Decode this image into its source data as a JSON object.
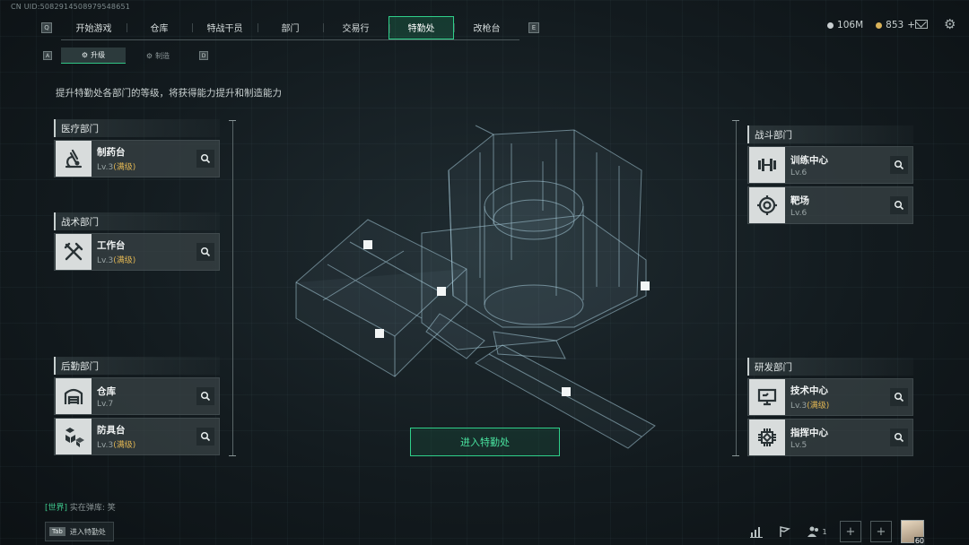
{
  "uid_label": "CN UID:5082914508979548651",
  "nav": {
    "left_key": "Q",
    "right_key": "E",
    "tabs": [
      {
        "label": "开始游戏"
      },
      {
        "label": "仓库"
      },
      {
        "label": "特战干员"
      },
      {
        "label": "部门"
      },
      {
        "label": "交易行"
      },
      {
        "label": "特勤处",
        "active": true
      },
      {
        "label": "改枪台"
      }
    ]
  },
  "currency": {
    "silver": "106M",
    "gold": "853"
  },
  "subnav": {
    "left_key": "A",
    "right_key": "D",
    "tabs": [
      {
        "label": "升级",
        "active": true
      },
      {
        "label": "制造"
      }
    ]
  },
  "description": "提升特勤处各部门的等级，将获得能力提升和制造能力",
  "departments": {
    "medical": {
      "title": "医疗部门",
      "items": [
        {
          "name": "制药台",
          "level": "Lv.3",
          "max": "(满级)",
          "icon": "microscope-icon"
        }
      ]
    },
    "tactical": {
      "title": "战术部门",
      "items": [
        {
          "name": "工作台",
          "level": "Lv.3",
          "max": "(满级)",
          "icon": "tools-icon"
        }
      ]
    },
    "logistics": {
      "title": "后勤部门",
      "items": [
        {
          "name": "仓库",
          "level": "Lv.7",
          "max": "",
          "icon": "warehouse-icon"
        },
        {
          "name": "防具台",
          "level": "Lv.3",
          "max": "(满级)",
          "icon": "armor-crates-icon"
        }
      ]
    },
    "combat": {
      "title": "战斗部门",
      "items": [
        {
          "name": "训练中心",
          "level": "Lv.6",
          "max": "",
          "icon": "dumbbell-icon"
        },
        {
          "name": "靶场",
          "level": "Lv.6",
          "max": "",
          "icon": "target-icon"
        }
      ]
    },
    "research": {
      "title": "研发部门",
      "items": [
        {
          "name": "技术中心",
          "level": "Lv.3",
          "max": "(满级)",
          "icon": "computer-icon"
        },
        {
          "name": "指挥中心",
          "level": "Lv.5",
          "max": "",
          "icon": "chip-icon"
        }
      ]
    }
  },
  "enter_button": "进入特勤处",
  "chat": {
    "channel": "[世界]",
    "message": "实在弹库: 笑"
  },
  "tab_hint": {
    "key": "Tab",
    "label": "进入特勤处"
  },
  "bottom_bar": {
    "friends_count": "1",
    "avatar_level": "60"
  },
  "colors": {
    "accent_green": "#2fd08a",
    "max_level_gold": "#e0b553"
  }
}
